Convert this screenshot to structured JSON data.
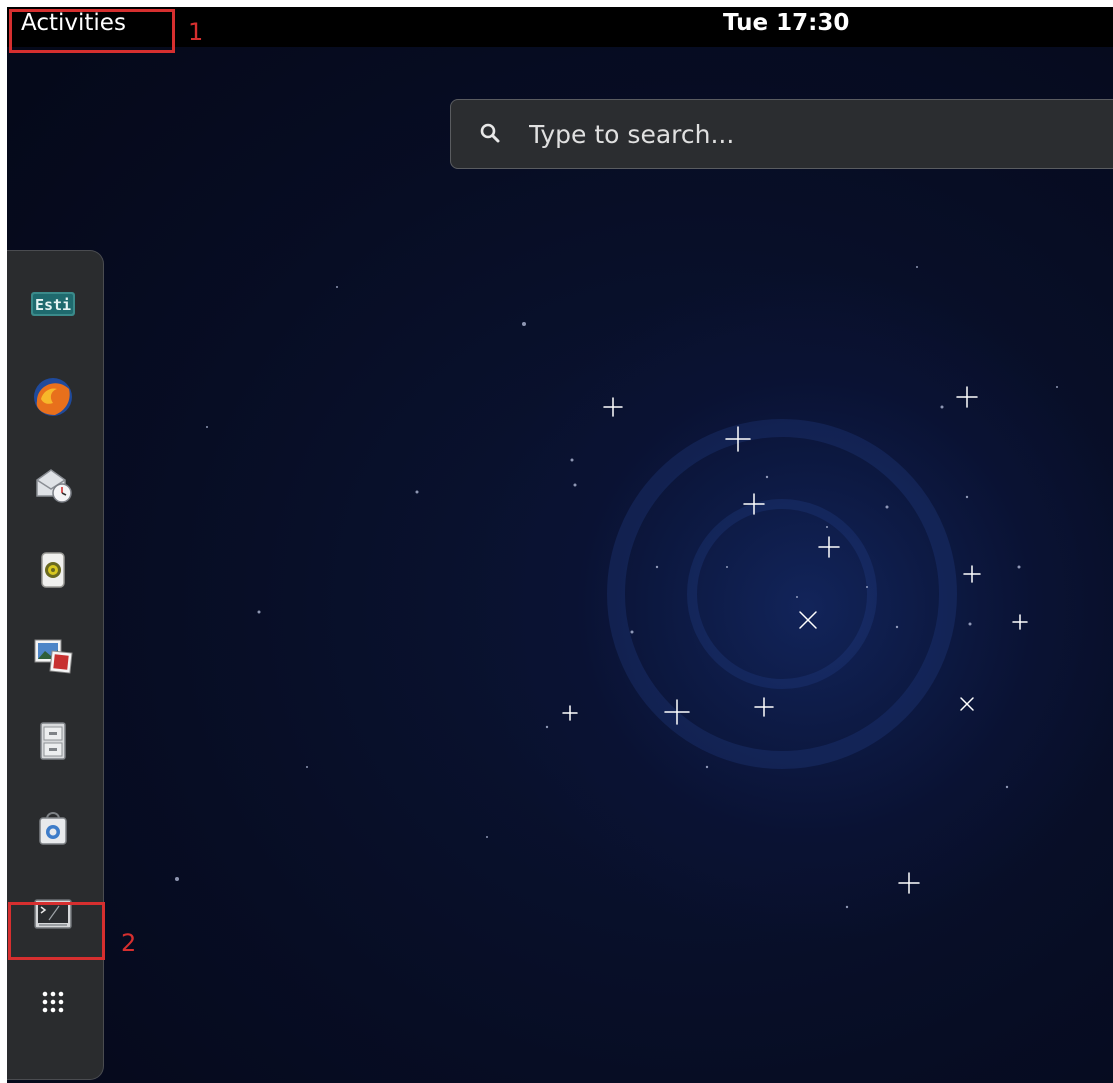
{
  "topbar": {
    "activities_label": "Activities",
    "clock": "Tue 17:30"
  },
  "search": {
    "placeholder": "Type to search..."
  },
  "annotations": [
    {
      "label": "1"
    },
    {
      "label": "2"
    }
  ],
  "dash": {
    "items": [
      {
        "name": "esti-app",
        "icon": "esti-badge-icon",
        "badge_text": "Esti"
      },
      {
        "name": "firefox",
        "icon": "firefox-icon"
      },
      {
        "name": "evolution-mail",
        "icon": "mail-clock-icon"
      },
      {
        "name": "rhythmbox",
        "icon": "speaker-icon"
      },
      {
        "name": "image-viewer",
        "icon": "photos-icon"
      },
      {
        "name": "files",
        "icon": "file-cabinet-icon"
      },
      {
        "name": "software",
        "icon": "shopping-bag-icon"
      },
      {
        "name": "terminal",
        "icon": "terminal-icon",
        "highlighted": true
      },
      {
        "name": "show-applications",
        "icon": "app-grid-icon"
      }
    ]
  },
  "colors": {
    "highlight": "#d62f2f",
    "topbar_bg": "#000000",
    "dash_bg": "#2a2c2e",
    "search_bg": "#2b2d30"
  }
}
